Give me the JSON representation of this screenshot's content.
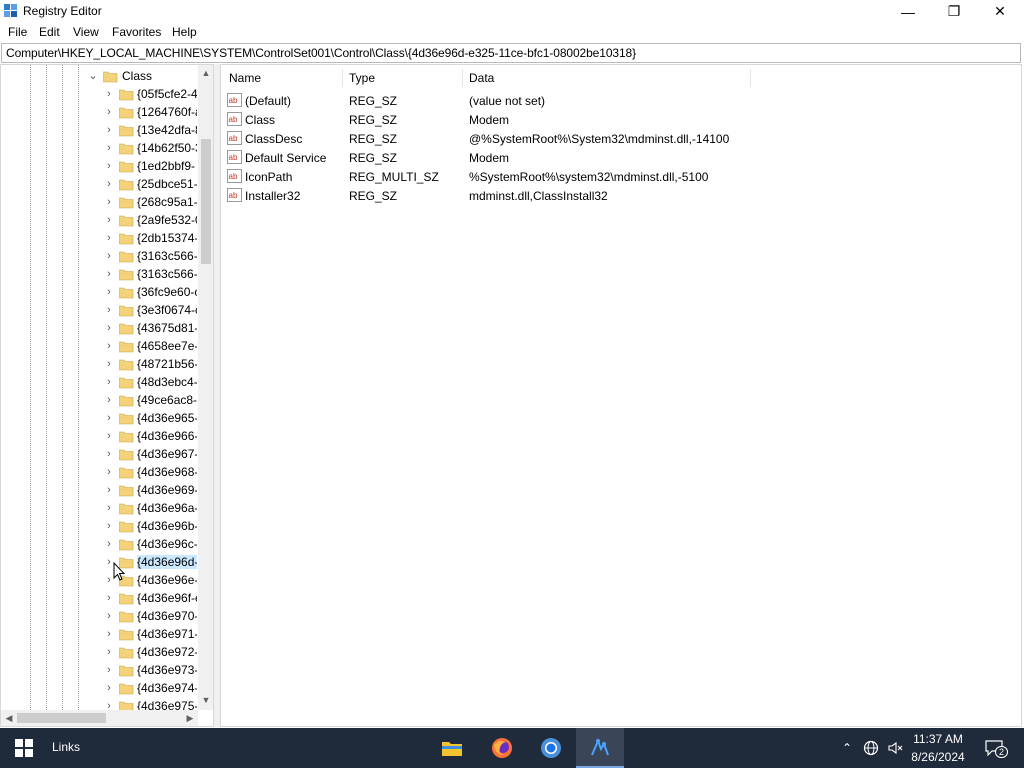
{
  "window": {
    "title": "Registry Editor",
    "minimize_glyph": "—",
    "maximize_glyph": "❐",
    "close_glyph": "✕"
  },
  "menu": [
    "File",
    "Edit",
    "View",
    "Favorites",
    "Help"
  ],
  "address": "Computer\\HKEY_LOCAL_MACHINE\\SYSTEM\\ControlSet001\\Control\\Class\\{4d36e96d-e325-11ce-bfc1-08002be10318}",
  "tree": {
    "parent": "Class",
    "children": [
      "{05f5cfe2-4",
      "{1264760f-a",
      "{13e42dfa-8",
      "{14b62f50-3",
      "{1ed2bbf9-",
      "{25dbce51-",
      "{268c95a1-",
      "{2a9fe532-0",
      "{2db15374-",
      "{3163c566-",
      "{3163c566-",
      "{36fc9e60-c",
      "{3e3f0674-c",
      "{43675d81-",
      "{4658ee7e-",
      "{48721b56-",
      "{48d3ebc4-",
      "{49ce6ac8-",
      "{4d36e965-",
      "{4d36e966-",
      "{4d36e967-",
      "{4d36e968-",
      "{4d36e969-",
      "{4d36e96a-",
      "{4d36e96b-",
      "{4d36e96c-",
      "{4d36e96d-",
      "{4d36e96e-",
      "{4d36e96f-e",
      "{4d36e970-",
      "{4d36e971-",
      "{4d36e972-",
      "{4d36e973-",
      "{4d36e974-",
      "{4d36e975-"
    ],
    "selected_index": 26
  },
  "list": {
    "headers": {
      "name": "Name",
      "type": "Type",
      "data": "Data"
    },
    "rows": [
      {
        "name": "(Default)",
        "type": "REG_SZ",
        "data": "(value not set)"
      },
      {
        "name": "Class",
        "type": "REG_SZ",
        "data": "Modem"
      },
      {
        "name": "ClassDesc",
        "type": "REG_SZ",
        "data": "@%SystemRoot%\\System32\\mdminst.dll,-14100"
      },
      {
        "name": "Default Service",
        "type": "REG_SZ",
        "data": "Modem"
      },
      {
        "name": "IconPath",
        "type": "REG_MULTI_SZ",
        "data": "%SystemRoot%\\system32\\mdminst.dll,-5100"
      },
      {
        "name": "Installer32",
        "type": "REG_SZ",
        "data": "mdminst.dll,ClassInstall32"
      }
    ]
  },
  "taskbar": {
    "links_label": "Links",
    "apps": [
      "file-explorer",
      "firefox",
      "chrome",
      "registry-editor"
    ],
    "active_app": "registry-editor",
    "time": "11:37 AM",
    "date": "8/26/2024",
    "notification_count": "2"
  },
  "colors": {
    "taskbar": "#1f2a3a",
    "selection": "#cce8ff",
    "folder": "#f4d27a"
  }
}
